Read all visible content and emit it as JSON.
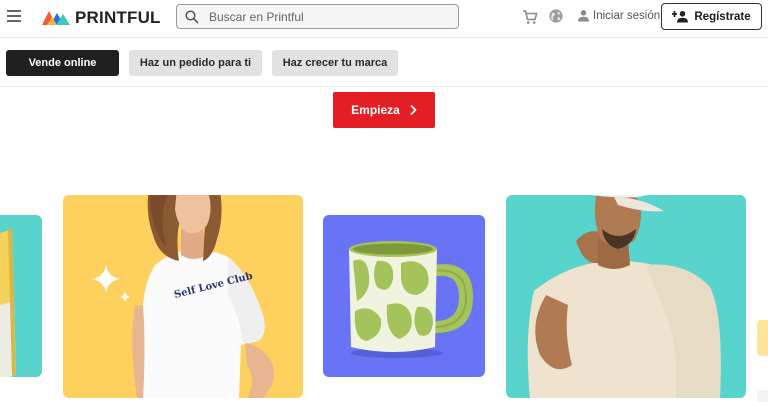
{
  "header": {
    "brand": "PRINTFUL",
    "search_placeholder": "Buscar en Printful",
    "login_label": "Iniciar sesión",
    "register_label": "Regístrate"
  },
  "tabs": [
    {
      "label": "Vende online",
      "active": true
    },
    {
      "label": "Haz un pedido para ti",
      "active": false
    },
    {
      "label": "Haz crecer tu marca",
      "active": false
    }
  ],
  "cta": {
    "label": "Empieza"
  },
  "shirt_print": "Self Love Club",
  "colors": {
    "cta": "#e31e24",
    "active_tab": "#202020",
    "teal_card": "#59d4cd",
    "yellow_card": "#fed05e",
    "blue_card": "#6874f5",
    "mug_green": "#a4c35a"
  }
}
